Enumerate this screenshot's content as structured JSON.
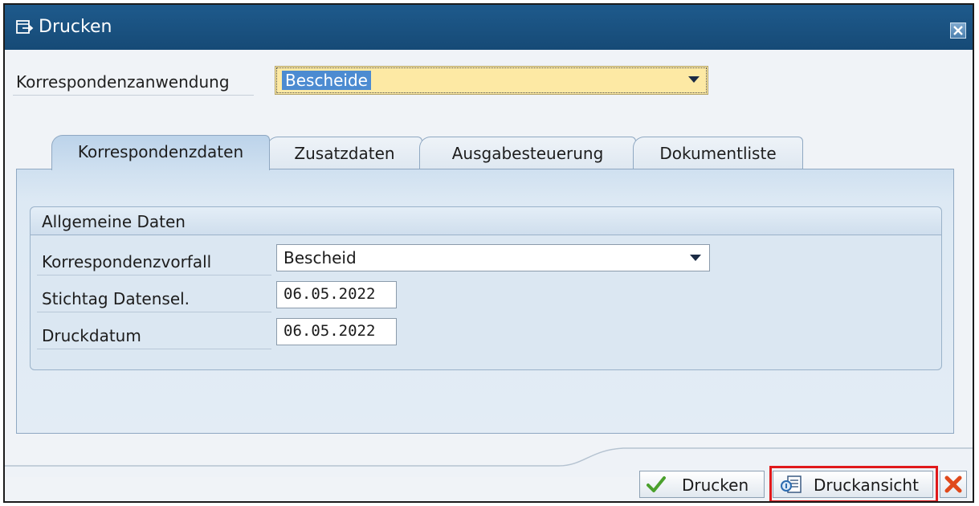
{
  "window": {
    "title": "Drucken"
  },
  "top_field": {
    "label": "Korrespondenzanwendung",
    "value": "Bescheide"
  },
  "tabs": [
    {
      "label": "Korrespondenzdaten",
      "active": true
    },
    {
      "label": "Zusatzdaten",
      "active": false
    },
    {
      "label": "Ausgabesteuerung",
      "active": false
    },
    {
      "label": "Dokumentliste",
      "active": false
    }
  ],
  "group": {
    "title": "Allgemeine Daten",
    "fields": [
      {
        "label": "Korrespondenzvorfall",
        "value": "Bescheid"
      },
      {
        "label": "Stichtag Datensel.",
        "value": "06.05.2022"
      },
      {
        "label": "Druckdatum",
        "value": "06.05.2022"
      }
    ]
  },
  "buttons": {
    "print": "Drucken",
    "preview": "Druckansicht"
  },
  "colors": {
    "titlebar": "#1e5a8c",
    "required_field": "#fde9a4",
    "highlight": "#e0191b",
    "tab_active": "#bcd3ea"
  },
  "icons": {
    "title": "print-dialog-icon",
    "close": "close-icon",
    "print": "checkmark-icon",
    "preview": "print-preview-icon",
    "cancel": "cancel-icon"
  }
}
